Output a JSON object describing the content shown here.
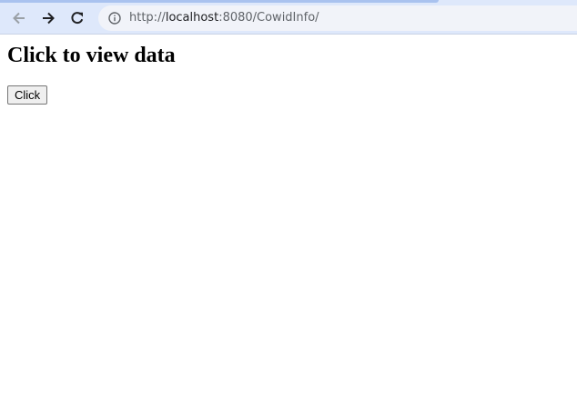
{
  "browser": {
    "url_scheme": "http://",
    "url_host": "localhost",
    "url_rest": ":8080/CowidInfo/",
    "icons": {
      "back": "back-arrow-icon",
      "forward": "forward-arrow-icon",
      "reload": "reload-icon",
      "site_info": "info-icon"
    }
  },
  "page": {
    "heading": "Click to view data",
    "button_label": "Click"
  },
  "colors": {
    "toolbar_bg": "#dee8fb",
    "omnibox_bg": "#f1f3f9",
    "icon_color": "#5f6368"
  }
}
